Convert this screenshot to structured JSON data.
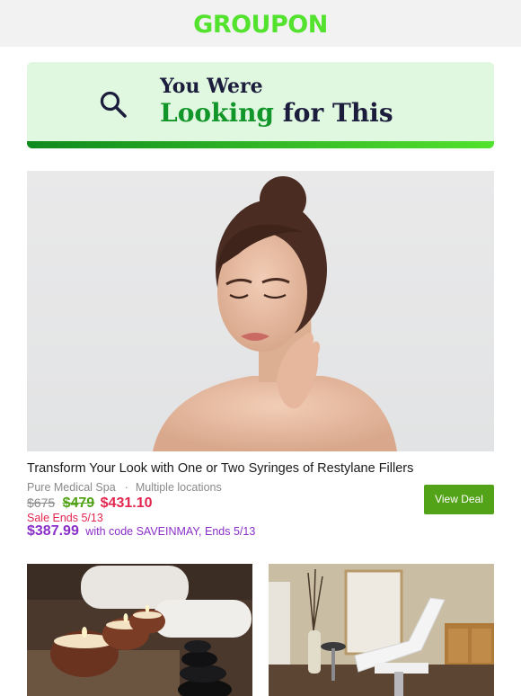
{
  "header": {
    "logo_text": "GROUPON",
    "logo_color": "#53e22d"
  },
  "banner": {
    "line1": "You Were",
    "line2_highlight": "Looking",
    "line2_rest": "for This",
    "icon": "search-icon"
  },
  "deal": {
    "title": "Transform Your Look with One or Two Syringes of Restylane Fillers",
    "merchant": "Pure Medical Spa",
    "separator": "·",
    "location": "Multiple locations",
    "original_price": "$675",
    "regular_price": "$479",
    "sale_price": "$431.10",
    "sale_ends": "Sale Ends 5/13",
    "code_price": "$387.99",
    "code_text": "with code SAVEINMAY, Ends 5/13",
    "button_label": "View Deal"
  },
  "colors": {
    "brand_green": "#53e22d",
    "button_green": "#53a318",
    "sale_red": "#e3264f",
    "promo_purple": "#8a2fc8"
  }
}
